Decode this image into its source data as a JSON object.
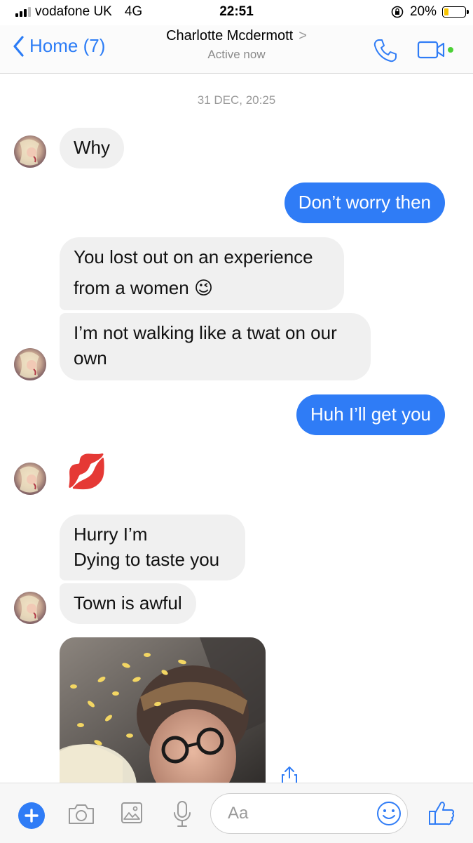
{
  "status": {
    "carrier": "vodafone UK",
    "network": "4G",
    "time": "22:51",
    "battery": "20%",
    "battery_level": 0.2
  },
  "header": {
    "back_label": "Home (7)",
    "contact_name": "Charlotte Mcdermott",
    "status": "Active now"
  },
  "conversation": {
    "timestamp": "31 DEC, 20:25",
    "messages": [
      {
        "side": "in",
        "text": "Why"
      },
      {
        "side": "out",
        "text": "Don’t worry then"
      },
      {
        "side": "in",
        "line1": "You lost out on an experience",
        "line2": "from a women",
        "emoji": "😉"
      },
      {
        "side": "in",
        "line1": "I’m not walking like a twat on our",
        "line2": "own"
      },
      {
        "side": "out",
        "text": "Huh I’ll get you"
      },
      {
        "side": "in",
        "emoji": "💋"
      },
      {
        "side": "in",
        "line1": "Hurry I’m",
        "line2": "Dying to taste you"
      },
      {
        "side": "in",
        "text": "Town is awful"
      }
    ]
  },
  "composer": {
    "placeholder": "Aa"
  },
  "icons": {
    "back": "chevron-left-icon",
    "call": "phone-icon",
    "video": "video-camera-icon",
    "plus": "plus-icon",
    "camera": "camera-icon",
    "gallery": "image-icon",
    "mic": "microphone-icon",
    "emoji": "smiley-icon",
    "like": "thumbs-up-icon",
    "share": "share-icon"
  },
  "colors": {
    "accent": "#2f7cf6",
    "incoming_bubble": "#f0f0f0",
    "online_dot": "#4cd137",
    "battery_fill": "#f7c400"
  }
}
